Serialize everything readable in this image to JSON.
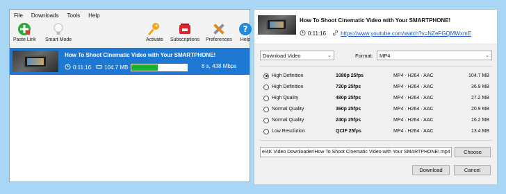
{
  "menu": [
    "File",
    "Downloads",
    "Tools",
    "Help"
  ],
  "toolbar": {
    "paste_link": "Paste Link",
    "smart_mode": "Smart Mode",
    "activate": "Activate",
    "subscriptions": "Subscriptions",
    "preferences": "Preferences",
    "help": "Help"
  },
  "download": {
    "title": "How To Shoot Cinematic Video with Your SMARTPHONE!",
    "duration": "0:11:16",
    "size": "104.7 MB",
    "progress_percent": 48,
    "speed": "8 s, 438 Mbps"
  },
  "dialog": {
    "title": "How To Shoot Cinematic Video with Your SMARTPHONE!",
    "duration": "0:11:16",
    "url": "https://www.youtube.com/watch?v=NZeFGQMWxmE",
    "mode": "Download Video",
    "format_label": "Format:",
    "format": "MP4",
    "options": [
      {
        "quality": "High Definition",
        "resolution": "1080p 25fps",
        "codec": "MP4 · H264 · AAC",
        "size": "104.7 MB",
        "selected": true
      },
      {
        "quality": "High Definition",
        "resolution": "720p 25fps",
        "codec": "MP4 · H264 · AAC",
        "size": "36.9 MB",
        "selected": false
      },
      {
        "quality": "High Quality",
        "resolution": "480p 25fps",
        "codec": "MP4 · H264 · AAC",
        "size": "27.2 MB",
        "selected": false
      },
      {
        "quality": "Normal Quality",
        "resolution": "360p 25fps",
        "codec": "MP4 · H264 · AAC",
        "size": "20.9 MB",
        "selected": false
      },
      {
        "quality": "Normal Quality",
        "resolution": "240p 25fps",
        "codec": "MP4 · H264 · AAC",
        "size": "16.2 MB",
        "selected": false
      },
      {
        "quality": "Low Resolution",
        "resolution": "QCIF 25fps",
        "codec": "MP4 · H264 · AAC",
        "size": "13.4 MB",
        "selected": false
      }
    ],
    "save_path": "e/4K Video Downloader/How To Shoot Cinematic Video with Your SMARTPHONE!.mp4",
    "choose": "Choose",
    "download_btn": "Download",
    "cancel": "Cancel"
  },
  "colors": {
    "background": "#a9d6f5",
    "selected_row": "#1e78d2",
    "progress": "#17b22d",
    "link": "#1a55b8"
  }
}
